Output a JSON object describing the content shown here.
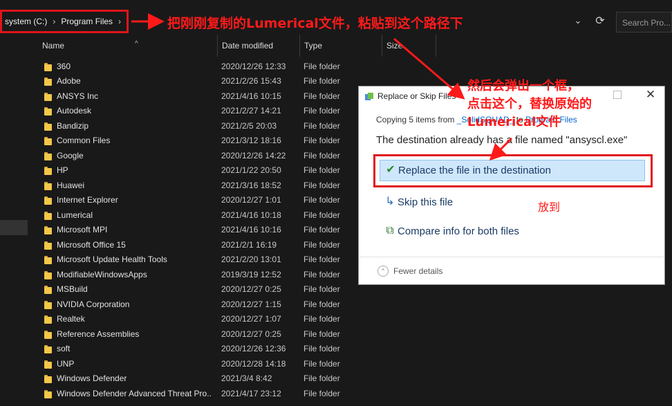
{
  "address_bar": {
    "segments": [
      "system (C:)",
      "Program Files"
    ],
    "search_placeholder": "Search Pro..."
  },
  "columns": {
    "name": "Name",
    "date_modified": "Date modified",
    "type": "Type",
    "size": "Size"
  },
  "files": [
    {
      "name": "360",
      "date": "2020/12/26 12:33",
      "type": "File folder"
    },
    {
      "name": "Adobe",
      "date": "2021/2/26 15:43",
      "type": "File folder"
    },
    {
      "name": "ANSYS Inc",
      "date": "2021/4/16 10:15",
      "type": "File folder"
    },
    {
      "name": "Autodesk",
      "date": "2021/2/27 14:21",
      "type": "File folder"
    },
    {
      "name": "Bandizip",
      "date": "2021/2/5 20:03",
      "type": "File folder"
    },
    {
      "name": "Common Files",
      "date": "2021/3/12 18:16",
      "type": "File folder"
    },
    {
      "name": "Google",
      "date": "2020/12/26 14:22",
      "type": "File folder"
    },
    {
      "name": "HP",
      "date": "2021/1/22 20:50",
      "type": "File folder"
    },
    {
      "name": "Huawei",
      "date": "2021/3/16 18:52",
      "type": "File folder"
    },
    {
      "name": "Internet Explorer",
      "date": "2020/12/27 1:01",
      "type": "File folder"
    },
    {
      "name": "Lumerical",
      "date": "2021/4/16 10:18",
      "type": "File folder"
    },
    {
      "name": "Microsoft MPI",
      "date": "2021/4/16 10:16",
      "type": "File folder"
    },
    {
      "name": "Microsoft Office 15",
      "date": "2021/2/1 16:19",
      "type": "File folder"
    },
    {
      "name": "Microsoft Update Health Tools",
      "date": "2021/2/20 13:01",
      "type": "File folder"
    },
    {
      "name": "ModifiableWindowsApps",
      "date": "2019/3/19 12:52",
      "type": "File folder"
    },
    {
      "name": "MSBuild",
      "date": "2020/12/27 0:25",
      "type": "File folder"
    },
    {
      "name": "NVIDIA Corporation",
      "date": "2020/12/27 1:15",
      "type": "File folder"
    },
    {
      "name": "Realtek",
      "date": "2020/12/27 1:07",
      "type": "File folder"
    },
    {
      "name": "Reference Assemblies",
      "date": "2020/12/27 0:25",
      "type": "File folder"
    },
    {
      "name": "soft",
      "date": "2020/12/26 12:36",
      "type": "File folder"
    },
    {
      "name": "UNP",
      "date": "2020/12/28 14:18",
      "type": "File folder"
    },
    {
      "name": "Windows Defender",
      "date": "2021/3/4 8:42",
      "type": "File folder"
    },
    {
      "name": "Windows Defender Advanced Threat Pro...",
      "date": "2021/4/17 23:12",
      "type": "File folder"
    }
  ],
  "dialog": {
    "title": "Replace or Skip Files",
    "copying_prefix": "Copying 5 items from ",
    "copying_source": "_SolidSQUAD_",
    "copying_middle": " to ",
    "copying_target": "Program Files",
    "destination_message": "The destination already has a file named \"ansyscl.exe\"",
    "options": {
      "replace": "Replace the file in the destination",
      "skip": "Skip this file",
      "compare": "Compare info for both files"
    },
    "fewer_details": "Fewer details"
  },
  "annotations": {
    "top_note": "把刚刚复制的Lumerical文件，粘贴到这个路径下",
    "dialog_note": [
      "然后会弹出一个框，",
      "点击这个，替换原始的",
      "Lumerical文件"
    ],
    "side_note": "放到"
  },
  "colors": {
    "background": "#191919",
    "annotation_red": "#ff1a1a",
    "dialog_selected": "#cfe7fb",
    "folder_yellow": "#f4c748"
  }
}
